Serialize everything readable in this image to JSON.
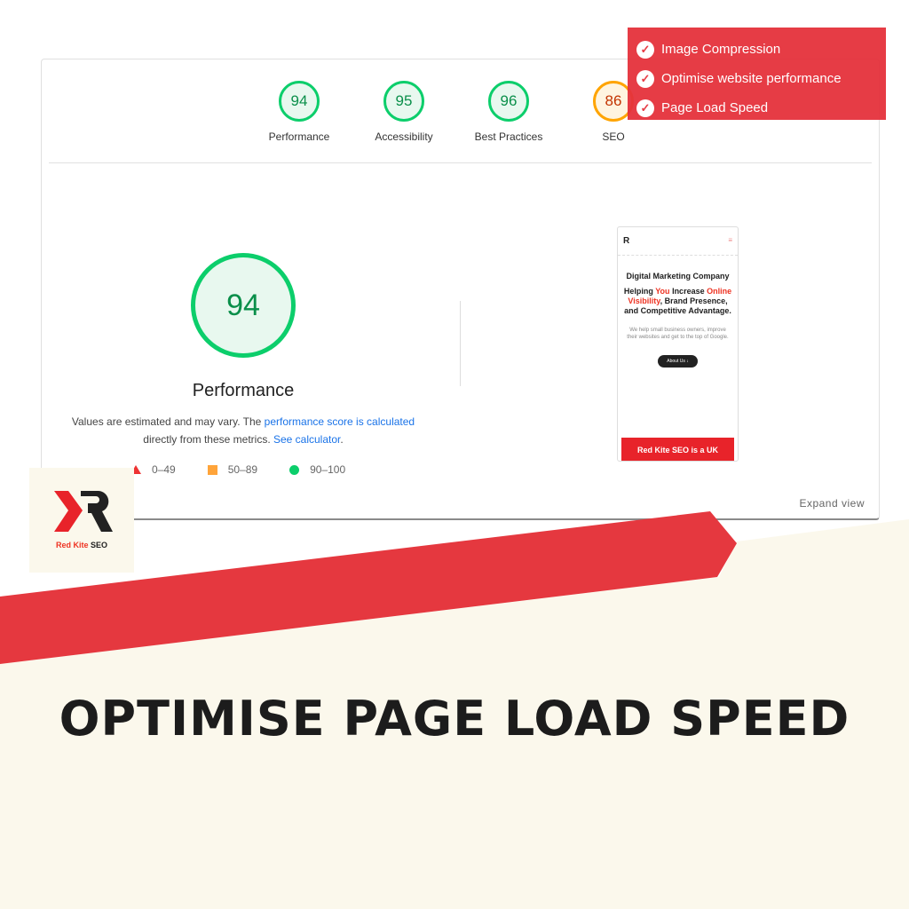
{
  "scores": [
    {
      "label": "Performance",
      "value": "94",
      "status": "good"
    },
    {
      "label": "Accessibility",
      "value": "95",
      "status": "good"
    },
    {
      "label": "Best Practices",
      "value": "96",
      "status": "good"
    },
    {
      "label": "SEO",
      "value": "86",
      "status": "average"
    }
  ],
  "main": {
    "score": "94",
    "label": "Performance",
    "desc_pre": "Values are estimated and may vary. The ",
    "desc_link1": "performance score is calculated",
    "desc_mid": "directly from these metrics. ",
    "desc_link2": "See calculator",
    "desc_end": "."
  },
  "legend": [
    {
      "icon": "triangle-icon",
      "range": "0–49"
    },
    {
      "icon": "square-icon",
      "range": "50–89"
    },
    {
      "icon": "circle-icon",
      "range": "90–100"
    }
  ],
  "preview": {
    "logo": "R",
    "title": "Digital Marketing Company",
    "s1": "Helping ",
    "s_you": "You",
    "s2": " Increase ",
    "s_vis": "Online Visibility",
    "s3": ", Brand Presence, and Competitive Advantage.",
    "para": "We help small business owners, improve their websites and get to the top of Google.",
    "button": "About Us ↓",
    "band": "Red Kite SEO is a UK"
  },
  "expand": "Expand view",
  "checklist": [
    "Image Compression",
    "Optimise website performance",
    "Page Load Speed"
  ],
  "brand": {
    "name_red": "Red Kite",
    "name_dark": "SEO",
    "accent": "#e5323c",
    "bg": "#fbf8ec"
  },
  "headline": "OPTIMISE PAGE LOAD SPEED"
}
